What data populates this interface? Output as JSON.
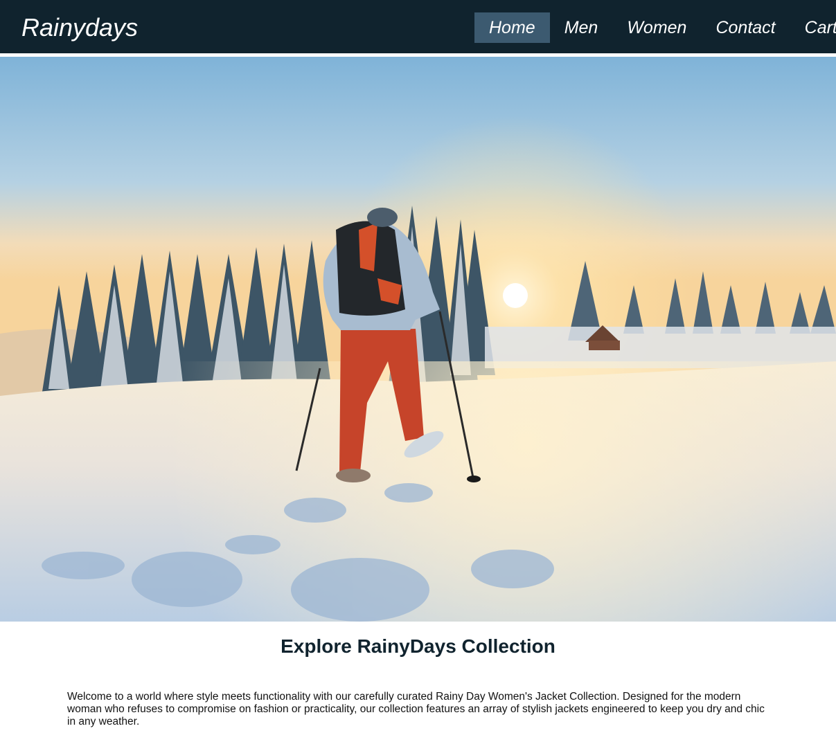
{
  "header": {
    "logo": "Rainydays",
    "nav": [
      {
        "label": "Home",
        "active": true
      },
      {
        "label": "Men",
        "active": false
      },
      {
        "label": "Women",
        "active": false
      },
      {
        "label": "Contact",
        "active": false
      },
      {
        "label": "Cart(",
        "active": false
      }
    ]
  },
  "hero": {
    "image_subject": "snowshoe-hiker-winter-forest-sunrise"
  },
  "main": {
    "headline": "Explore RainyDays Collection",
    "intro": "Welcome to a world where style meets functionality with our carefully curated Rainy Day Women's Jacket Collection. Designed for the modern woman who refuses to compromise on fashion or practicality, our collection features an array of stylish jackets engineered to keep you dry and chic in any weather."
  },
  "colors": {
    "header_bg": "#10232e",
    "nav_active_bg": "#3c5a70",
    "headline": "#10232e",
    "hiker_pants": "#c6442a"
  }
}
